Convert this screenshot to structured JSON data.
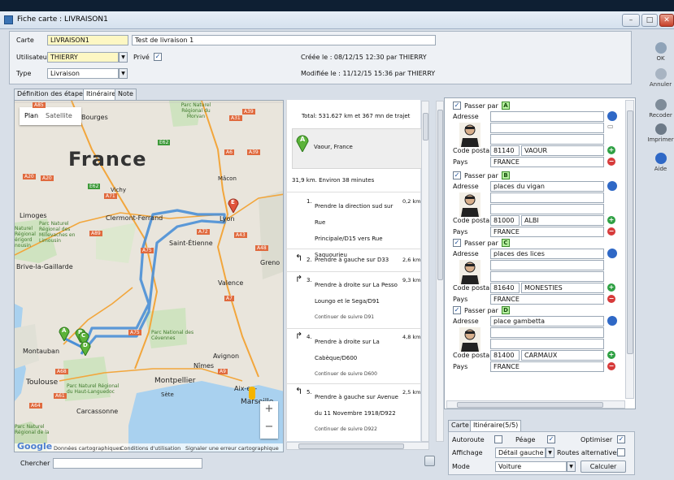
{
  "window": {
    "title": "Fiche carte : LIVRAISON1"
  },
  "header": {
    "carte_label": "Carte",
    "carte_value": "LIVRAISON1",
    "description": "Test de livraison 1",
    "user_label": "Utilisateur",
    "user_value": "THIERRY",
    "prive_label": "Privé",
    "type_label": "Type",
    "type_value": "Livraison",
    "created": "Créée le : 08/12/15 12:30 par THIERRY",
    "modified": "Modifiée le : 11/12/15 15:36 par THIERRY"
  },
  "side_buttons": {
    "ok": "OK",
    "annuler": "Annuler",
    "recoder": "Recoder",
    "imprimer": "Imprimer",
    "aide": "Aide"
  },
  "tabs": [
    "Définition des étapes",
    "Itinéraire",
    "Note"
  ],
  "map": {
    "plan": "Plan",
    "satellite": "Satellite",
    "country": "France",
    "cities": {
      "bourges": "Bourges",
      "limoges": "Limoges",
      "vichy": "Vichy",
      "macon": "Mâcon",
      "lyon": "Lyon",
      "clermont": "Clermont-Ferrand",
      "stetienne": "Saint-Étienne",
      "brive": "Brive-la-Gaillarde",
      "valence": "Valence",
      "montauban": "Montauban",
      "toulouse": "Toulouse",
      "nimes": "Nîmes",
      "avignon": "Avignon",
      "montpellier": "Montpellier",
      "sete": "Sète",
      "aix": "Aix-en-",
      "marseille": "Marseille",
      "carcassonne": "Carcassonne",
      "grenoble": "Greno"
    },
    "parks": {
      "morvan": "Parc Naturel Régional du Morvan",
      "volcans": "Parc Naturel Régional des Millevaches en Limousin",
      "cevennes": "Parc National des Cévennes",
      "haut_languedoc": "Parc Naturel Régional du Haut-Languedoc",
      "narbonnaise": "Parc Naturel Régional de la"
    },
    "left_labels": [
      "Naturel",
      "Régional",
      "érigord",
      "nousin"
    ],
    "roads": [
      "A71",
      "A6",
      "A39",
      "A31",
      "E21",
      "A20",
      "A89",
      "A75",
      "A72",
      "A43",
      "A48",
      "A7",
      "A9",
      "A61",
      "A68",
      "A64",
      "A8",
      "E62",
      "A5"
    ],
    "pins": [
      "A",
      "B",
      "C",
      "D",
      "E"
    ],
    "footer": {
      "logo": "Google",
      "data": "Données cartographiques",
      "terms": "Conditions d'utilisation",
      "report": "Signaler une erreur cartographique"
    },
    "zoom_in": "+",
    "zoom_out": "−"
  },
  "directions": {
    "total": "Total: 531.627 km et 367 mn de trajet",
    "start_pin": "A",
    "start_place": "Vaour, France",
    "leg": "31,9 km. Environ 38 minutes",
    "steps": [
      {
        "n": "1.",
        "text": "Prendre la direction sud sur Rue",
        "text2": "Principale/D15 vers Rue",
        "text3": "Saquourieu",
        "dist": "0,2 km"
      },
      {
        "n": "2.",
        "text": "Prendre à gauche sur D33",
        "dist": "2,6 km"
      },
      {
        "n": "3.",
        "text": "Prendre à droite sur La Pesso",
        "text2": "Loungo et le Sega/D91",
        "sub": "Continuer de suivre D91",
        "dist": "9,3 km"
      },
      {
        "n": "4.",
        "text": "Prendre à droite sur La",
        "text2": "Cabèque/D600",
        "sub": "Continuer de suivre D600",
        "dist": "4,8 km"
      },
      {
        "n": "5.",
        "text": "Prendre à gauche sur Avenue",
        "text2": "du 11 Novembre 1918/D922",
        "sub": "Continuer de suivre D922",
        "dist": "2,5 km"
      }
    ]
  },
  "stops": [
    {
      "letter": "A",
      "passer": "Passer par",
      "adresse_label": "Adresse",
      "adresse": "",
      "cp_label": "Code postal",
      "cp": "81140",
      "ville": "VAOUR",
      "pays_label": "Pays",
      "pays": "FRANCE"
    },
    {
      "letter": "B",
      "passer": "Passer par",
      "adresse_label": "Adresse",
      "adresse": "places du vigan",
      "cp_label": "Code postal",
      "cp": "81000",
      "ville": "ALBI",
      "pays_label": "Pays",
      "pays": "FRANCE"
    },
    {
      "letter": "C",
      "passer": "Passer par",
      "adresse_label": "Adresse",
      "adresse": "places des lices",
      "cp_label": "Code postal",
      "cp": "81640",
      "ville": "MONESTIES",
      "pays_label": "Pays",
      "pays": "FRANCE"
    },
    {
      "letter": "D",
      "passer": "Passer par",
      "adresse_label": "Adresse",
      "adresse": "place gambetta",
      "cp_label": "Code postal",
      "cp": "81400",
      "ville": "CARMAUX",
      "pays_label": "Pays",
      "pays": "FRANCE"
    }
  ],
  "options": {
    "tab_carte": "Carte",
    "tab_itin": "Itinéraire(5/5)",
    "autoroute": "Autoroute",
    "peage": "Péage",
    "optimiser": "Optimiser",
    "affichage": "Affichage",
    "affichage_value": "Détail gauche",
    "routes_alt": "Routes alternatives",
    "mode": "Mode",
    "mode_value": "Voiture",
    "calculer": "Calculer"
  },
  "search": {
    "label": "Chercher",
    "value": ""
  },
  "colors": {
    "route": "#4a8fd6",
    "pin_green": "#5cb33a",
    "pin_red": "#e0533c",
    "accent": "#3a73b4"
  }
}
